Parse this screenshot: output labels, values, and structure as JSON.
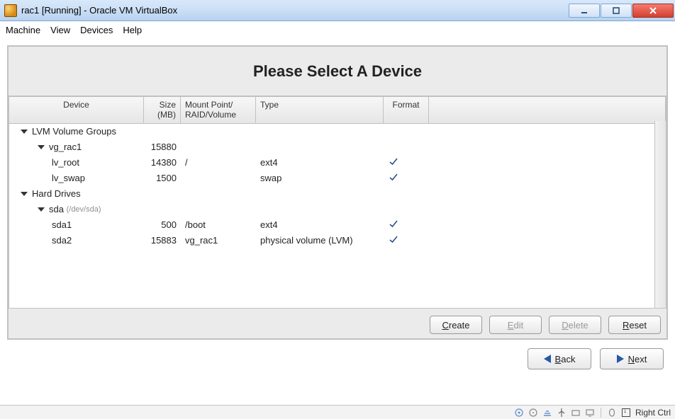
{
  "window": {
    "title": "rac1 [Running] - Oracle VM VirtualBox"
  },
  "menubar": {
    "machine": "Machine",
    "view": "View",
    "devices": "Devices",
    "help": "Help"
  },
  "panel": {
    "title": "Please Select A Device"
  },
  "columns": {
    "device": "Device",
    "size": "Size (MB)",
    "mount": "Mount Point/ RAID/Volume",
    "type": "Type",
    "format": "Format"
  },
  "groups": {
    "lvm_label": "LVM Volume Groups",
    "hard_drives_label": "Hard Drives"
  },
  "vg": {
    "name": "vg_rac1",
    "size": "15880",
    "lv_root": {
      "name": "lv_root",
      "size": "14380",
      "mount": "/",
      "type": "ext4",
      "format": true
    },
    "lv_swap": {
      "name": "lv_swap",
      "size": "1500",
      "mount": "",
      "type": "swap",
      "format": true
    }
  },
  "hd": {
    "sda": {
      "name": "sda",
      "devpath": "(/dev/sda)",
      "sda1": {
        "name": "sda1",
        "size": "500",
        "mount": "/boot",
        "type": "ext4",
        "format": true
      },
      "sda2": {
        "name": "sda2",
        "size": "15883",
        "mount": "vg_rac1",
        "type": "physical volume (LVM)",
        "format": true
      }
    }
  },
  "buttons": {
    "create": "Create",
    "edit": "Edit",
    "delete": "Delete",
    "reset": "Reset",
    "back": "Back",
    "next": "Next"
  },
  "statusbar": {
    "hostkey": "Right Ctrl"
  }
}
